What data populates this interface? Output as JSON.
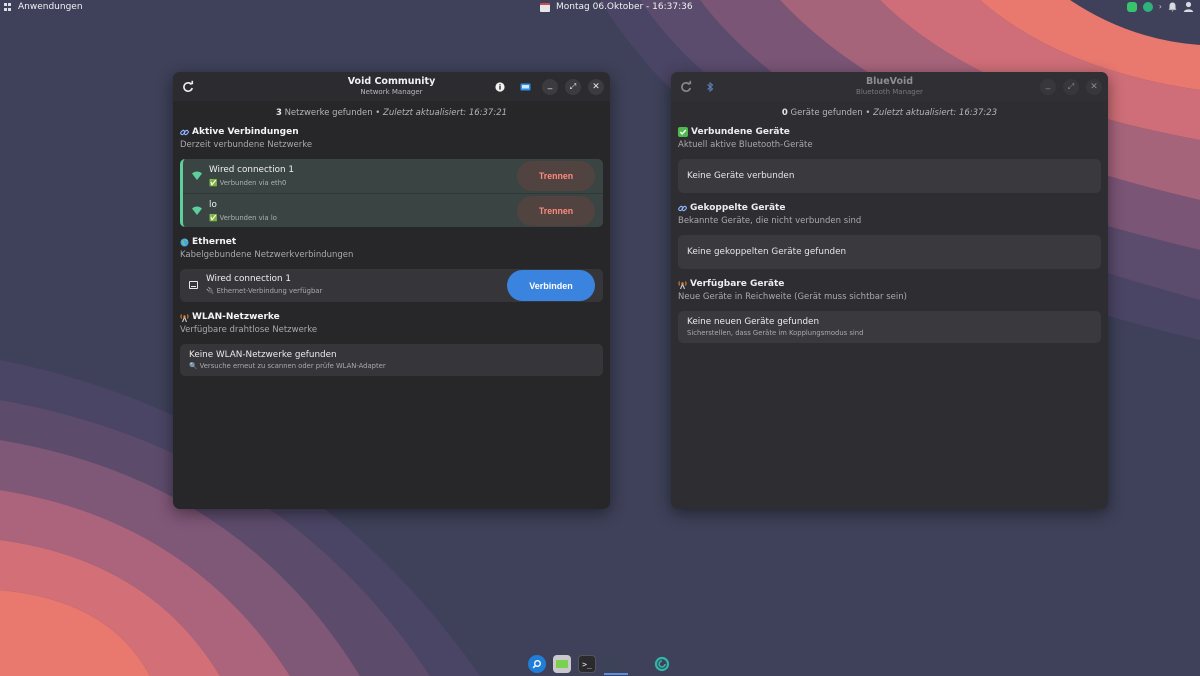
{
  "topbar": {
    "apps_label": "Anwendungen",
    "clock": "Montag 06.Oktober - 16:37:36"
  },
  "network_window": {
    "title": "Void Community",
    "subtitle": "Network Manager",
    "status": {
      "count": "3",
      "found_text": "Netzwerke gefunden",
      "separator": "•",
      "updated": "Zuletzt aktualisiert: 16:37:21"
    },
    "active": {
      "icon": "link-icon",
      "title": "Aktive Verbindungen",
      "subtitle": "Derzeit verbundene Netzwerke",
      "connections": [
        {
          "name": "Wired connection 1",
          "detail": "✅ Verbunden via eth0",
          "button": "Trennen"
        },
        {
          "name": "lo",
          "detail": "✅ Verbunden via lo",
          "button": "Trennen"
        }
      ]
    },
    "ethernet": {
      "icon": "globe-icon",
      "title": "Ethernet",
      "subtitle": "Kabelgebundene Netzwerkverbindungen",
      "item": {
        "name": "Wired connection 1",
        "detail": "🔌 Ethernet-Verbindung verfügbar",
        "button": "Verbinden"
      }
    },
    "wlan": {
      "icon": "antenna-icon",
      "title": "WLAN-Netzwerke",
      "subtitle": "Verfügbare drahtlose Netzwerke",
      "empty_main": "Keine WLAN-Netzwerke gefunden",
      "empty_hint": "🔍 Versuche erneut zu scannen oder prüfe WLAN-Adapter"
    }
  },
  "bluetooth_window": {
    "title": "BlueVoid",
    "subtitle": "Bluetooth Manager",
    "status": {
      "count": "0",
      "found_text": "Geräte gefunden",
      "separator": "•",
      "updated": "Zuletzt aktualisiert: 16:37:23"
    },
    "connected": {
      "title": "Verbundene Geräte",
      "subtitle": "Aktuell aktive Bluetooth-Geräte",
      "empty": "Keine Geräte verbunden"
    },
    "paired": {
      "title": "Gekoppelte Geräte",
      "subtitle": "Bekannte Geräte, die nicht verbunden sind",
      "empty": "Keine gekoppelten Geräte gefunden"
    },
    "available": {
      "title": "Verfügbare Geräte",
      "subtitle": "Neue Geräte in Reichweite (Gerät muss sichtbar sein)",
      "empty_main": "Keine neuen Geräte gefunden",
      "empty_hint": "Sicherstellen, dass Geräte im Kopplungsmodus sind"
    }
  },
  "colors": {
    "accent_blue": "#3a84e0",
    "success_green": "#5ecf9b",
    "danger_red": "#ff8a80"
  }
}
